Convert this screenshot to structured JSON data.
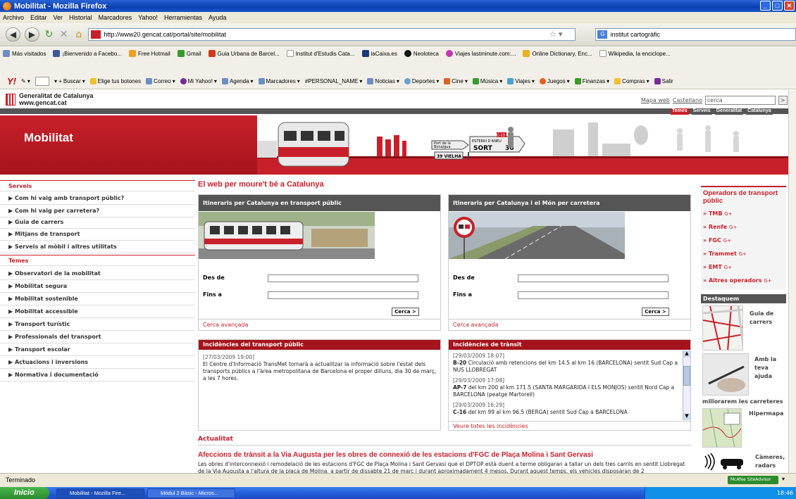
{
  "window": {
    "title": "Mobilitat - Mozilla Firefox"
  },
  "menu": [
    "Archivo",
    "Editar",
    "Ver",
    "Historial",
    "Marcadores",
    "Yahoo!",
    "Herramientas",
    "Ayuda"
  ],
  "nav": {
    "url": "http://www20.gencat.cat/portal/site/mobilitat",
    "search_value": "institut cartogràfic"
  },
  "bookmarks": [
    "Más visitados",
    "¡Bienvenido a Facebo...",
    "Free Hotmail",
    "Gmail",
    "Guia Urbana de Barcel...",
    "Institut d'Estudis Cata...",
    "laCaixa.es",
    "Neoloteca",
    "Viajes lastminute.com:...",
    "Online Dictionary, Enc...",
    "Wikipedia, la enciclope..."
  ],
  "yahoo_toolbar": {
    "buscar": "Buscar",
    "items": [
      "Elige tus botones",
      "Correo",
      "Mi Yahoo!",
      "Agenda",
      "Marcadores",
      "#PERSONAL_NAME",
      "Noticias",
      "Deportes",
      "Cine",
      "Música",
      "Viajes",
      "Juegos",
      "Finanzas",
      "Compras",
      "Salir"
    ]
  },
  "site": {
    "logo_line1": "Generalitat de Catalunya",
    "logo_line2": "www.gencat.cat",
    "mapa_web": "Mapa web",
    "castellano": "Castellano",
    "search_value": "cerca",
    "search_btn": ">",
    "topnav": [
      "Temes",
      "Serveis",
      "Generalitat",
      "Catalunya"
    ],
    "banner_title": "Mobilitat",
    "sign1_l1": "Port de la",
    "sign1_l2": "Bonaigua",
    "sign2_l1": "ESTERRI D'ANEU",
    "sign2_l2": "SORT",
    "sign2_n1": "4",
    "sign2_n2": "36",
    "sign3": "39 VIELHA",
    "sign_code": "C-13"
  },
  "sidebar": {
    "serveis_head": "Serveis",
    "serveis": [
      "Com hi vaig amb transport públic?",
      "Com hi vaig per carretera?",
      "Guia de carrers",
      "Mitjans de transport",
      "Serveis al mòbil i altres utilitats"
    ],
    "temes_head": "Temes",
    "temes": [
      "Observatori de la mobilitat",
      "Mobilitat segura",
      "Mobilitat sostenible",
      "Mobilitat accessible",
      "Transport turístic",
      "Professionals del transport",
      "Transport escolar",
      "Actuacions i inversions",
      "Normativa i documentació"
    ],
    "arrow": "▶"
  },
  "main": {
    "heading": "El web per moure't bé a Catalunya",
    "panel1_title": "Itineraris per Catalunya en transport públic",
    "panel2_title": "Itineraris per Catalunya i el Món per carretera",
    "des_de": "Des de",
    "fins_a": "Fins a",
    "cerca_btn": "Cerca >",
    "cerca_avancada": "Cerca avançada",
    "inc1_title": "Incidències del transport públic",
    "inc1_date": "[27/03/2009 19:00]",
    "inc1_text": "El Centre d'Informació TransMet tornarà a actualitzar la informació sobre l'estat dels transports públics a l'àrea metropolitana de Barcelona el proper dilluns, dia 30 de març, a les 7 hores.",
    "inc2_title": "Incidències de trànsit",
    "inc2_items": [
      {
        "date": "[29/03/2009 18:07]",
        "code": "B-20",
        "text": " Circulació amb retencions del km 14.5 al km 16 (BARCELONA) sentit Sud Cap a NUS LLOBREGAT"
      },
      {
        "date": "[29/03/2009 17:08]",
        "code": "AP-7",
        "text": " del km 200 al km 171.5 (SANTA MARGARIDA I ELS MONJOS) sentit Nord Cap a BARCELONA (peatge Martorell)"
      },
      {
        "date": "[29/03/2009 16:29]",
        "code": "C-16",
        "text": " del km 99 al km 96.5 (BERGA) sentit Sud Cap a BARCELONA"
      }
    ],
    "veure_totes": "Veure totes les incidències",
    "actualitat": "Actualitat",
    "act_title": "Afeccions de trànsit a la Via Augusta per les obres de connexió de les estacions d'FGC de Plaça Molina i Sant Gervasi",
    "act_text": "Les obres d'interconnexió i remodelació de les estacions d'FGC de Plaça Molina i Sant Gervasi que el DPTOP està duent a terme obligaran a tallar un dels tres carrils en sentit Llobregat de la Via Augusta a l'altura de la plaça de Molina, a partir de dissabte 21 de març i durant aproximadament 4 mesos. Durant aquest temps, els vehicles disposaran de 2"
  },
  "right": {
    "ops_head": "Operadors de transport públic",
    "ops": [
      "» TMB",
      "» Renfe",
      "» FGC",
      "» Trammet",
      "» EMT",
      "» Altres operadors"
    ],
    "ext": "G+",
    "destaquem": "Destaquem",
    "guia": "Guia de carrers",
    "amb_teva": "Amb la teva ajuda",
    "millorarem": "millorarem les carreteres",
    "hipermapa": "Hipermapa",
    "cameres": "Càmeres, radars"
  },
  "status": {
    "text": "Terminado",
    "mcafee": "McAfee SiteAdvisor"
  },
  "taskbar": {
    "start": "Inicio",
    "items": [
      "Mobilitat - Mozilla Fire...",
      "Mòdul 2 Bàsic - Micros..."
    ],
    "clock": "18:46"
  }
}
